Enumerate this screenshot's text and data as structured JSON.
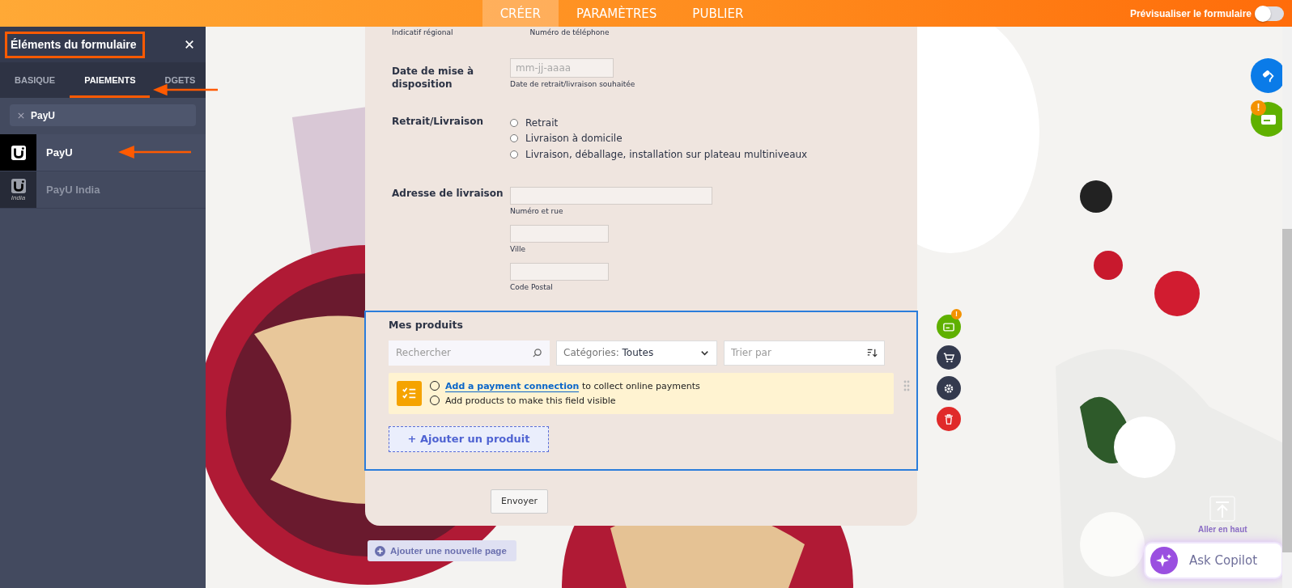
{
  "topbar": {
    "tabs": [
      {
        "label": "CRÉER",
        "selected": true
      },
      {
        "label": "PARAMÈTRES",
        "selected": false
      },
      {
        "label": "PUBLIER",
        "selected": false
      }
    ],
    "preview": {
      "label": "Prévisualiser le formulaire",
      "on": false
    }
  },
  "sidebar": {
    "title": "Éléments du formulaire",
    "tabs": [
      {
        "label": "BASIQUE",
        "selected": false
      },
      {
        "label": "PAIEMENTS",
        "selected": true
      },
      {
        "label": "DGETS",
        "selected": false
      }
    ],
    "search": {
      "value": "PayU"
    },
    "items": [
      {
        "label": "PayU",
        "selected": true
      },
      {
        "label": "PayU India",
        "selected": false,
        "logo_caption": "India"
      }
    ]
  },
  "form": {
    "top_sublabels": [
      "Indicatif régional",
      "Numéro de téléphone"
    ],
    "fields": [
      {
        "kind": "date",
        "label": "Date de mise à disposition",
        "placeholder": "mm-jj-aaaa",
        "sublabel": "Date de retrait/livraison souhaitée"
      },
      {
        "kind": "radio",
        "label": "Retrait/Livraison",
        "options": [
          {
            "label": "Retrait",
            "checked": false
          },
          {
            "label": "Livraison à domicile",
            "checked": false
          },
          {
            "label": "Livraison, déballage, installation sur plateau multiniveaux",
            "checked": false
          }
        ]
      },
      {
        "kind": "address",
        "label": "Adresse de livraison",
        "inputs": [
          {
            "sublabel": "Numéro et rue"
          },
          {
            "sublabel": "Ville"
          },
          {
            "sublabel": "Code Postal"
          }
        ]
      }
    ],
    "products": {
      "title": "Mes produits",
      "selected": true,
      "search_placeholder": "Rechercher",
      "category_prefix": "Catégories:",
      "category_value": "Toutes",
      "sort_placeholder": "Trier par",
      "notice": [
        {
          "link": "Add a payment connection",
          "text": " to collect online payments",
          "done": false
        },
        {
          "text": "Add products to make this field visible",
          "done": false
        }
      ],
      "add_button": "+ Ajouter un produit"
    },
    "submit": "Envoyer"
  },
  "add_page": "Ajouter une nouvelle page",
  "payment_badge": "!",
  "field_payment_badge": "!",
  "go_top": "Aller en haut",
  "copilot": "Ask Copilot"
}
